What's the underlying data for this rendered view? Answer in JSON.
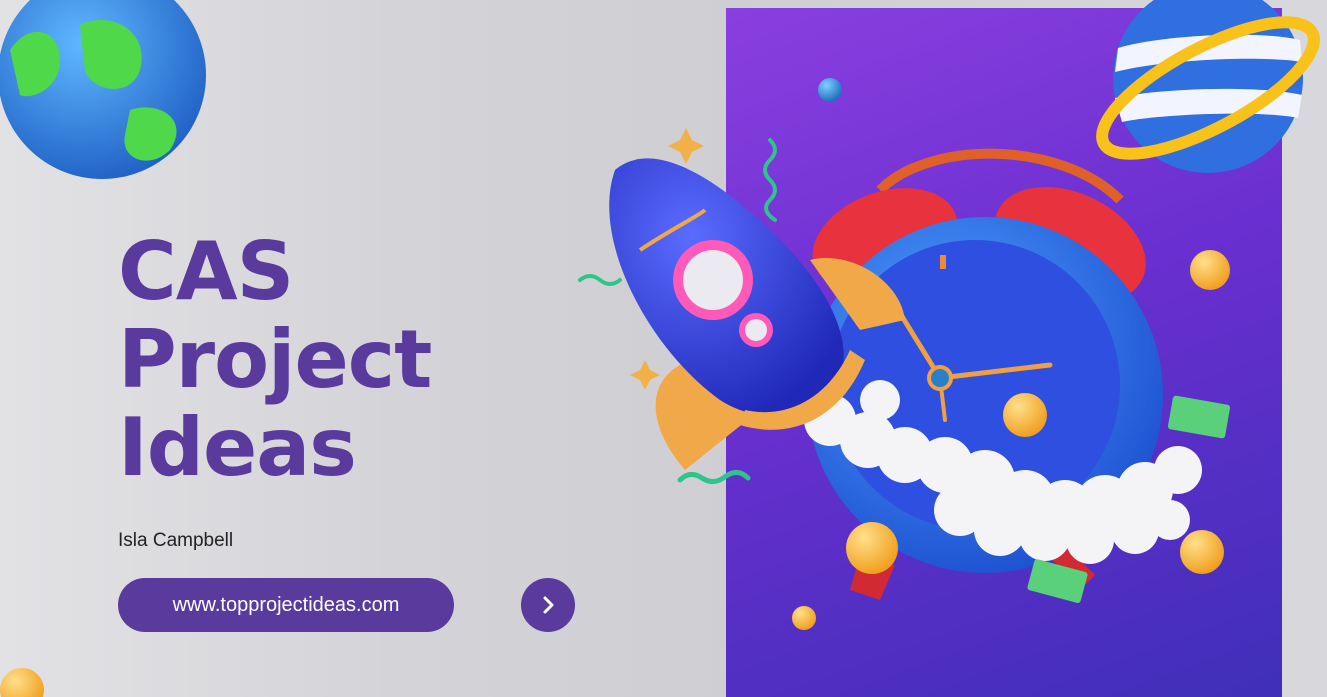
{
  "slide": {
    "title_lines": [
      "CAS",
      "Project",
      "Ideas"
    ],
    "author": "Isla Campbell",
    "url": "www.topprojectideas.com",
    "next_icon": "chevron-right-icon"
  },
  "colors": {
    "title": "#5b3a9e",
    "pill": "#5b3a9e",
    "panel_top": "#8a3fe0",
    "panel_bottom": "#3f2fb8"
  }
}
